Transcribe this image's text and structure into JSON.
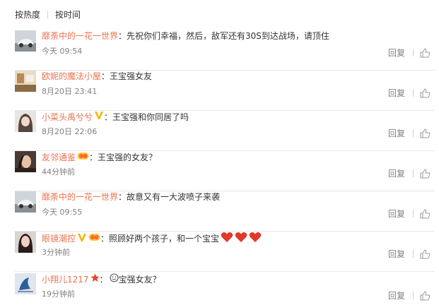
{
  "sort": {
    "hot_label": "按热度",
    "time_label": "按时间"
  },
  "actions": {
    "reply_label": "回复"
  },
  "comments": [
    {
      "username": "靡荼中的一花一世界",
      "colon": "：",
      "text": "先祝你们幸福，然后，敌军还有30S到达战场，请顶住",
      "time": "今天 09:54",
      "badges": [],
      "avatar": "car"
    },
    {
      "username": "欧妮的魔法小屋",
      "colon": "：",
      "text": "王宝强女友",
      "time": "8月20日 23:41",
      "badges": [],
      "avatar": "room"
    },
    {
      "username": "小菜头禹兮兮",
      "colon": "：",
      "text": "王宝强和你同居了吗",
      "time": "8月20日 22:06",
      "badges": [
        "v-icon"
      ],
      "avatar": "girl"
    },
    {
      "username": "友邻通鉴",
      "colon": "：",
      "text": "王宝强的女友？",
      "time": "44分钟前",
      "badges": [
        "fan-badge-icon"
      ],
      "avatar": "woman"
    },
    {
      "username": "靡荼中的一花一世界",
      "colon": "：",
      "text": "故意又有一大波喷子来袭",
      "time": "今天 09:55",
      "badges": [],
      "avatar": "car"
    },
    {
      "username": "眼镜潮控",
      "colon": "：",
      "text": "照顾好两个孩子，和一个宝宝",
      "time": "3分钟前",
      "badges": [
        "v-icon",
        "fan-badge-icon"
      ],
      "emojis": [
        "heart",
        "heart",
        "heart"
      ],
      "avatar": "lady"
    },
    {
      "username": "小翔儿1217",
      "colon": "：",
      "text": "宝强女友？",
      "time": "19分钟前",
      "badges": [
        "star-icon"
      ],
      "prefix_emoji": "smile",
      "avatar": "bird"
    }
  ]
}
